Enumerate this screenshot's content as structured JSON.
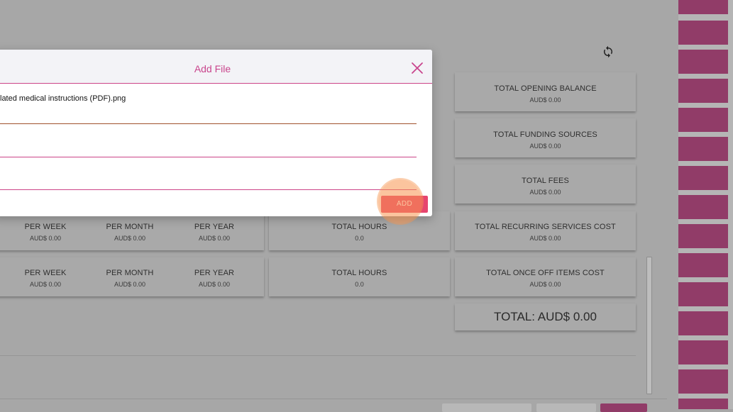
{
  "modal": {
    "title": "Add File",
    "filename": "lated medical instructions (PDF).png",
    "add_label": "ADD"
  },
  "summary_rows": [
    {
      "cells": [
        {
          "label": "PER WEEK",
          "value": "AUD$ 0.00"
        },
        {
          "label": "PER MONTH",
          "value": "AUD$ 0.00"
        },
        {
          "label": "PER YEAR",
          "value": "AUD$ 0.00"
        }
      ],
      "hours": {
        "label": "TOTAL HOURS",
        "value": "0.0"
      }
    },
    {
      "cells": [
        {
          "label": "PER WEEK",
          "value": "AUD$ 0.00"
        },
        {
          "label": "PER MONTH",
          "value": "AUD$ 0.00"
        },
        {
          "label": "PER YEAR",
          "value": "AUD$ 0.00"
        }
      ],
      "hours": {
        "label": "TOTAL HOURS",
        "value": "0.0"
      }
    }
  ],
  "totals": [
    {
      "label": "TOTAL OPENING BALANCE",
      "value": "AUD$ 0.00"
    },
    {
      "label": "TOTAL FUNDING SOURCES",
      "value": "AUD$ 0.00"
    },
    {
      "label": "TOTAL FEES",
      "value": "AUD$ 0.00"
    },
    {
      "label": "TOTAL RECURRING SERVICES COST",
      "value": "AUD$ 0.00"
    },
    {
      "label": "TOTAL ONCE OFF ITEMS COST",
      "value": "AUD$ 0.00"
    }
  ],
  "grand_total": "TOTAL: AUD$ 0.00",
  "icons": {
    "refresh": "refresh-icon",
    "close": "close-icon"
  },
  "colors": {
    "accent": "#c9458d",
    "add_button": "#e6456f",
    "sidebar_stripe": "#913c68",
    "overlay": "#a7a7a7"
  }
}
